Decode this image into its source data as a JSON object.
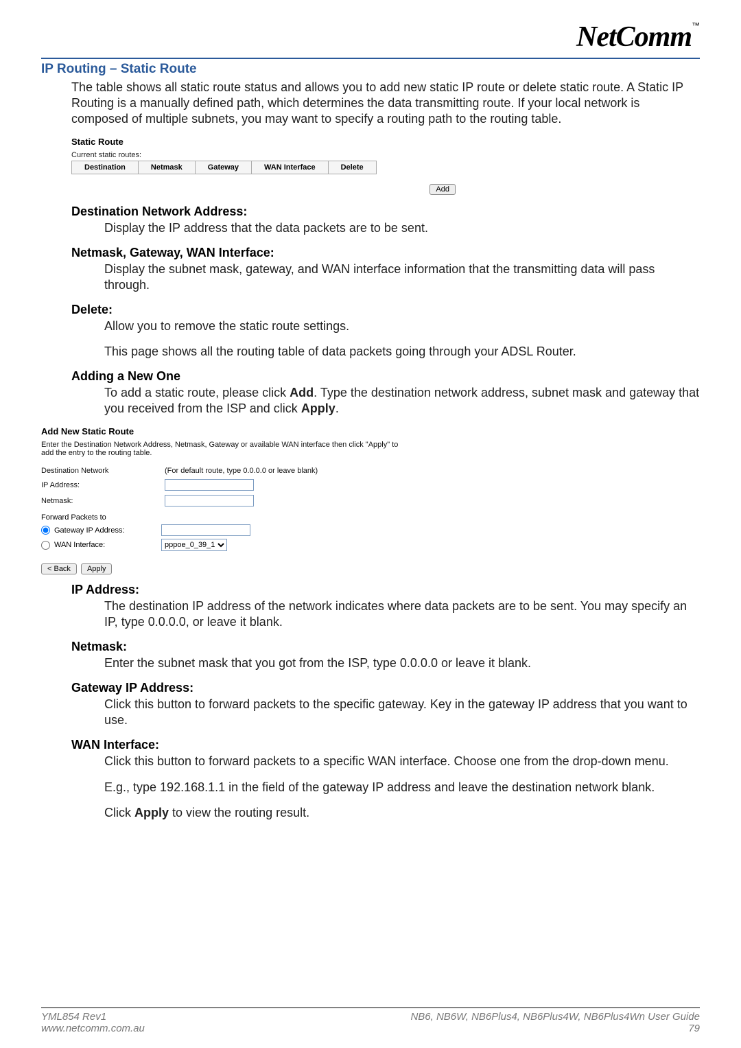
{
  "logo": {
    "text": "NetComm",
    "tm": "™"
  },
  "section_title": "IP Routing – Static Route",
  "intro": "The table shows all static route status and allows you to add new static IP route or delete static route. A Static IP Routing is a manually defined path, which determines the data transmitting route. If your local network is composed of multiple subnets, you may want to specify a routing path to the routing table.",
  "ui_routes": {
    "title": "Static Route",
    "subtitle": "Current static routes:",
    "headers": [
      "Destination",
      "Netmask",
      "Gateway",
      "WAN Interface",
      "Delete"
    ],
    "add_btn": "Add"
  },
  "defs": [
    {
      "term": "Destination Network Address:",
      "body": "Display the IP address that the data packets are to be sent."
    },
    {
      "term": "Netmask, Gateway, WAN Interface:",
      "body": "Display the subnet mask, gateway, and WAN interface information that the transmitting data will pass through."
    },
    {
      "term": "Delete:",
      "body": "Allow you to remove the static route settings."
    }
  ],
  "delete_extra": "This page shows all the routing table of data packets going through your ADSL Router.",
  "adding": {
    "heading": "Adding a New One",
    "text_a": "To add a static route, please click ",
    "add_word": "Add",
    "text_b": ". Type the destination network address, subnet mask and gateway that you received from the ISP and click ",
    "apply_word": "Apply",
    "text_c": "."
  },
  "ui_add": {
    "title": "Add New Static Route",
    "desc": "Enter the Destination Network Address, Netmask, Gateway or available WAN interface then click \"Apply\" to add the entry to the routing table.",
    "dest_label": "Destination Network",
    "dest_hint": "(For default route, type 0.0.0.0 or leave blank)",
    "ip_label": "IP Address:",
    "netmask_label": "Netmask:",
    "forward_label": "Forward Packets to",
    "gateway_label": "Gateway IP Address:",
    "wan_label": "WAN Interface:",
    "wan_option": "pppoe_0_39_1",
    "back_btn": "< Back",
    "apply_btn": "Apply"
  },
  "defs2": [
    {
      "term": "IP Address:",
      "body": "The destination IP address of the network indicates where data packets are to be sent. You may specify an IP, type 0.0.0.0, or leave it blank."
    },
    {
      "term": "Netmask:",
      "body": "Enter the subnet mask that you got from the ISP, type 0.0.0.0 or leave it blank."
    },
    {
      "term": "Gateway IP Address:",
      "body": "Click this button to forward packets to the specific gateway. Key in the gateway IP address that you want to use."
    },
    {
      "term": "WAN Interface:",
      "body": "Click this button to forward packets to a specific WAN interface. Choose one from the drop-down menu."
    }
  ],
  "wan_extra1": "E.g., type 192.168.1.1 in the field of the gateway IP address and leave the destination network blank.",
  "wan_extra2_a": "Click ",
  "wan_extra2_bold": "Apply",
  "wan_extra2_b": " to view the routing result.",
  "footer": {
    "left1": "YML854 Rev1",
    "left2": "www.netcomm.com.au",
    "right1": "NB6, NB6W, NB6Plus4, NB6Plus4W, NB6Plus4Wn User Guide",
    "right2": "79"
  }
}
